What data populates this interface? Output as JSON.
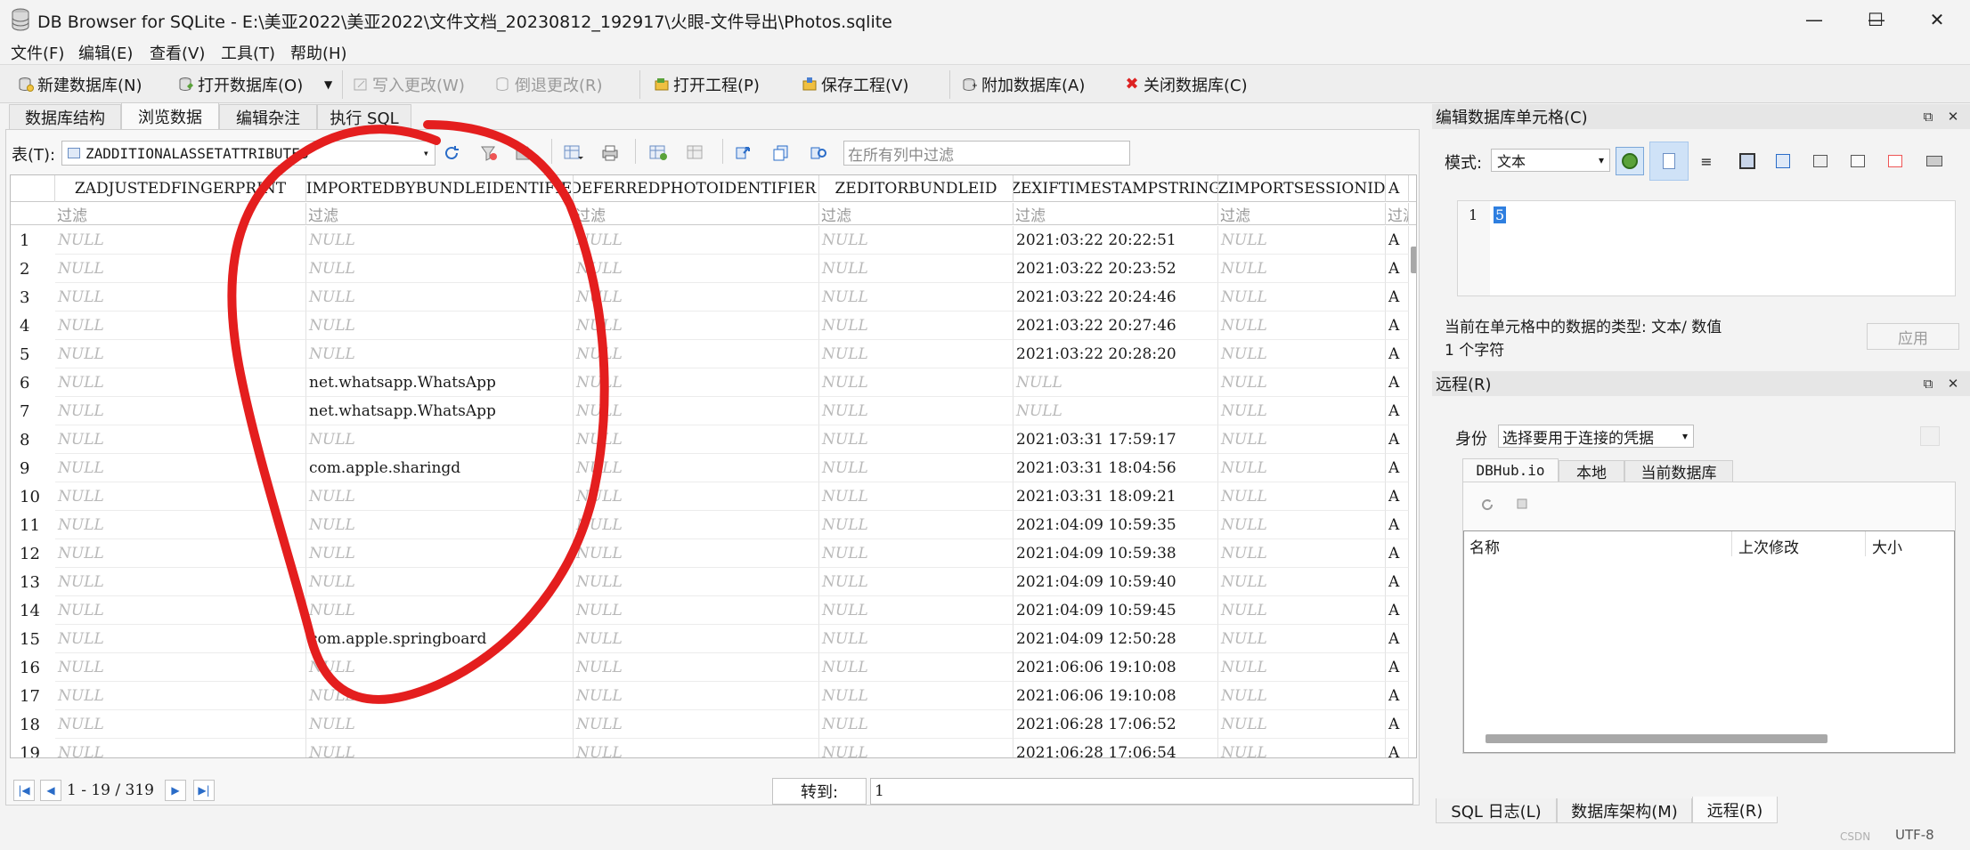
{
  "window": {
    "title": "DB Browser for SQLite - E:\\美亚2022\\美亚2022\\文件文档_20230812_192917\\火眼-文件导出\\Photos.sqlite",
    "minimize_glyph": "—",
    "maximize_glyph": "☐",
    "close_glyph": "✕"
  },
  "menu": [
    "文件(F)",
    "编辑(E)",
    "查看(V)",
    "工具(T)",
    "帮助(H)"
  ],
  "toolbar": {
    "new_db": "新建数据库(N)",
    "open_db": "打开数据库(O)",
    "write_changes": "写入更改(W)",
    "revert_changes": "倒退更改(R)",
    "open_project": "打开工程(P)",
    "save_project": "保存工程(V)",
    "attach_db": "附加数据库(A)",
    "close_db": "关闭数据库(C)"
  },
  "tabs": [
    "数据库结构",
    "浏览数据",
    "编辑杂注",
    "执行 SQL"
  ],
  "browse": {
    "table_label": "表(T):",
    "table_name": "ZADDITIONALASSETATTRIBUTES",
    "filter_all_placeholder": "在所有列中过滤",
    "filter_placeholder": "过滤",
    "columns": [
      "ZADJUSTEDFINGERPRINT",
      "ZIMPORTEDBYBUNDLEIDENTIFIER",
      "ZDEFERREDPHOTOIDENTIFIER",
      "ZEDITORBUNDLEID",
      "ZEXIFTIMESTAMPSTRING",
      "ZIMPORTSESSIONID",
      "A"
    ],
    "sort_indicator": "▼¹",
    "rows": [
      [
        "1",
        "NULL",
        "NULL",
        "NULL",
        "NULL",
        "2021:03:22 20:22:51",
        "NULL",
        "A"
      ],
      [
        "2",
        "NULL",
        "NULL",
        "NULL",
        "NULL",
        "2021:03:22 20:23:52",
        "NULL",
        "A"
      ],
      [
        "3",
        "NULL",
        "NULL",
        "NULL",
        "NULL",
        "2021:03:22 20:24:46",
        "NULL",
        "A"
      ],
      [
        "4",
        "NULL",
        "NULL",
        "NULL",
        "NULL",
        "2021:03:22 20:27:46",
        "NULL",
        "A"
      ],
      [
        "5",
        "NULL",
        "NULL",
        "NULL",
        "NULL",
        "2021:03:22 20:28:20",
        "NULL",
        "A"
      ],
      [
        "6",
        "NULL",
        "net.whatsapp.WhatsApp",
        "NULL",
        "NULL",
        "NULL",
        "NULL",
        "A"
      ],
      [
        "7",
        "NULL",
        "net.whatsapp.WhatsApp",
        "NULL",
        "NULL",
        "NULL",
        "NULL",
        "A"
      ],
      [
        "8",
        "NULL",
        "NULL",
        "NULL",
        "NULL",
        "2021:03:31 17:59:17",
        "NULL",
        "A"
      ],
      [
        "9",
        "NULL",
        "com.apple.sharingd",
        "NULL",
        "NULL",
        "2021:03:31 18:04:56",
        "NULL",
        "A"
      ],
      [
        "10",
        "NULL",
        "NULL",
        "NULL",
        "NULL",
        "2021:03:31 18:09:21",
        "NULL",
        "A"
      ],
      [
        "11",
        "NULL",
        "NULL",
        "NULL",
        "NULL",
        "2021:04:09 10:59:35",
        "NULL",
        "A"
      ],
      [
        "12",
        "NULL",
        "NULL",
        "NULL",
        "NULL",
        "2021:04:09 10:59:38",
        "NULL",
        "A"
      ],
      [
        "13",
        "NULL",
        "NULL",
        "NULL",
        "NULL",
        "2021:04:09 10:59:40",
        "NULL",
        "A"
      ],
      [
        "14",
        "NULL",
        "NULL",
        "NULL",
        "NULL",
        "2021:04:09 10:59:45",
        "NULL",
        "A"
      ],
      [
        "15",
        "NULL",
        "com.apple.springboard",
        "NULL",
        "NULL",
        "2021:04:09 12:50:28",
        "NULL",
        "A"
      ],
      [
        "16",
        "NULL",
        "NULL",
        "NULL",
        "NULL",
        "2021:06:06 19:10:08",
        "NULL",
        "A"
      ],
      [
        "17",
        "NULL",
        "NULL",
        "NULL",
        "NULL",
        "2021:06:06 19:10:08",
        "NULL",
        "A"
      ],
      [
        "18",
        "NULL",
        "NULL",
        "NULL",
        "NULL",
        "2021:06:28 17:06:52",
        "NULL",
        "A"
      ],
      [
        "19",
        "NULL",
        "NULL",
        "NULL",
        "NULL",
        "2021:06:28 17:06:54",
        "NULL",
        "A"
      ]
    ],
    "pagination": "1 - 19 / 319",
    "goto_label": "转到:",
    "goto_value": "1"
  },
  "edit_cell": {
    "title": "编辑数据库单元格(C)",
    "mode_label": "模式:",
    "mode_value": "文本",
    "line_number": "1",
    "content": "5",
    "type_info": "当前在单元格中的数据的类型: 文本/ 数值",
    "char_count": "1 个字符",
    "apply": "应用"
  },
  "remote": {
    "title": "远程(R)",
    "identity_label": "身份",
    "identity_value": "选择要用于连接的凭据",
    "tabs": [
      "DBHub.io",
      "本地",
      "当前数据库"
    ],
    "columns": [
      "名称",
      "上次修改",
      "大小"
    ]
  },
  "bottom_tabs": [
    "SQL 日志(L)",
    "数据库架构(M)",
    "远程(R)"
  ],
  "status": {
    "encoding": "UTF-8",
    "watermark": "CSDN"
  },
  "colors": {
    "annotation": "#e41e1e",
    "selection": "#3b86d8",
    "accent": "#2a6cc8"
  }
}
